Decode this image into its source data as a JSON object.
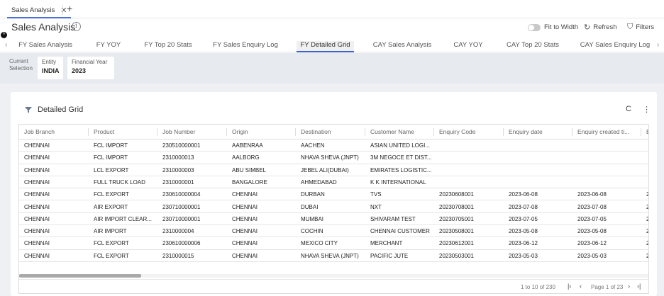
{
  "tabstrip": {
    "tab_label": "Sales Analysis",
    "close_glyph": "✕",
    "new_tab_glyph": "+"
  },
  "header": {
    "title": "Sales Analysis",
    "info_glyph": "i",
    "fit_to_width_label": "Fit to Width",
    "refresh_label": "Refresh",
    "filters_label": "Filters",
    "refresh_icon": "↻",
    "filter_icon": "⛉"
  },
  "report_tabs": {
    "left_arrow": "‹",
    "right_arrow": "›",
    "items": [
      {
        "label": "FY Sales Analysis"
      },
      {
        "label": "FY YOY"
      },
      {
        "label": "FY Top 20 Stats"
      },
      {
        "label": "FY Sales Enquiry Log"
      },
      {
        "label": "FY Detailed Grid"
      },
      {
        "label": "CAY Sales Analysis"
      },
      {
        "label": "CAY YOY"
      },
      {
        "label": "CAY Top 20 Stats"
      },
      {
        "label": "CAY Sales Enquiry Log"
      }
    ],
    "active_index": 4
  },
  "selection": {
    "label": "Current Selection",
    "entity_key": "Entity",
    "entity_value": "INDIA",
    "fy_key": "Financial Year",
    "fy_value": "2023"
  },
  "panel": {
    "title": "Detailed Grid",
    "refresh_glyph": "C",
    "more_glyph": "⋮"
  },
  "grid": {
    "columns": [
      "Job Branch",
      "Product",
      "Job Number",
      "Origin",
      "Destination",
      "Customer Name",
      "Enquiry Code",
      "Enquiry date",
      "Enquiry created ti...",
      "E"
    ],
    "rows": [
      [
        "CHENNAI",
        "FCL IMPORT",
        "230510000001",
        "AABENRAA",
        "AACHEN",
        "ASIAN UNITED LOGI...",
        "",
        "",
        "",
        ""
      ],
      [
        "CHENNAI",
        "FCL IMPORT",
        "2310000013",
        "AALBORG",
        "NHAVA SHEVA (JNPT)",
        "3M NEGOCE ET DIST...",
        "",
        "",
        "",
        ""
      ],
      [
        "CHENNAI",
        "LCL EXPORT",
        "2310000003",
        "ABU SIMBEL",
        "JEBEL ALI(DUBAI)",
        "EMIRATES LOGISTIC...",
        "",
        "",
        "",
        ""
      ],
      [
        "CHENNAI",
        "FULL TRUCK LOAD",
        "2310000001",
        "BANGALORE",
        "AHMEDABAD",
        "K K INTERNATIONAL",
        "",
        "",
        "",
        ""
      ],
      [
        "CHENNAI",
        "FCL EXPORT",
        "230610000004",
        "CHENNAI",
        "DURBAN",
        "TVS",
        "20230608001",
        "2023-06-08",
        "2023-06-08",
        "2"
      ],
      [
        "CHENNAI",
        "AIR EXPORT",
        "230710000001",
        "CHENNAI",
        "DUBAI",
        "NXT",
        "20230708001",
        "2023-07-08",
        "2023-07-08",
        "2"
      ],
      [
        "CHENNAI",
        "AIR IMPORT CLEAR...",
        "230710000001",
        "CHENNAI",
        "MUMBAI",
        "SHIVARAM TEST",
        "20230705001",
        "2023-07-05",
        "2023-07-05",
        "2"
      ],
      [
        "CHENNAI",
        "AIR IMPORT",
        "2310000004",
        "CHENNAI",
        "COCHIN",
        "CHENNAI CUSTOMER",
        "20230508001",
        "2023-05-08",
        "2023-05-08",
        "2"
      ],
      [
        "CHENNAI",
        "FCL EXPORT",
        "230610000006",
        "CHENNAI",
        "MEXICO CITY",
        "MERCHANT",
        "20230612001",
        "2023-06-12",
        "2023-06-12",
        "2"
      ],
      [
        "CHENNAI",
        "FCL EXPORT",
        "2310000015",
        "CHENNAI",
        "NHAVA SHEVA (JNPT)",
        "PACIFIC JUTE",
        "20230503001",
        "2023-05-03",
        "2023-05-03",
        "2"
      ]
    ]
  },
  "pager": {
    "range_text": "1 to 10 of 230",
    "page_text": "Page 1 of 23",
    "first": "|‹",
    "prev": "‹",
    "next": "›",
    "last": "›|"
  },
  "colors": {
    "accent": "#3b64c8",
    "band": "#e7eaef",
    "canvas": "#eef0f3"
  }
}
